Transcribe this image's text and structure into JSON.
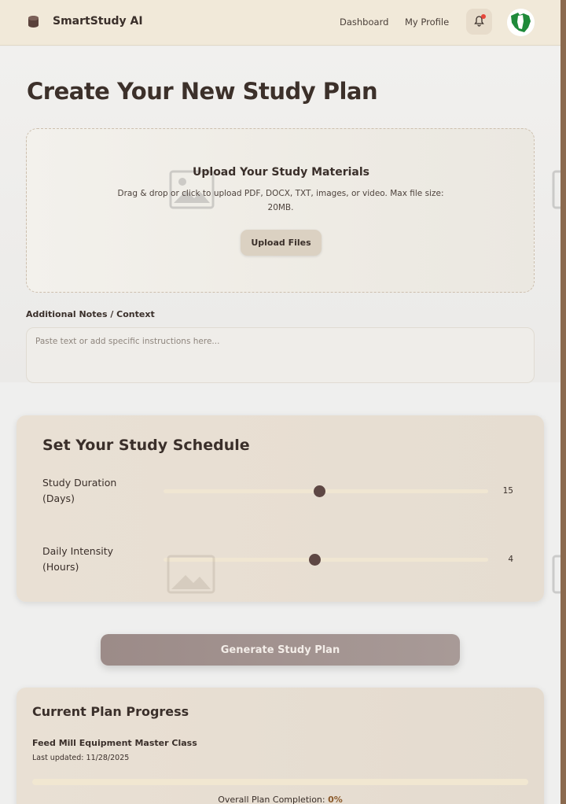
{
  "header": {
    "brand": "SmartStudy AI",
    "nav": [
      "Dashboard",
      "My Profile"
    ],
    "notification_dot_color": "#e6463a"
  },
  "main": {
    "title": "Create Your New Study Plan",
    "upload": {
      "title": "Upload Your Study Materials",
      "description": "Drag & drop or click to upload PDF, DOCX, TXT, images, or video. Max file size: 20MB.",
      "button": "Upload Files"
    },
    "notes": {
      "label": "Additional Notes / Context",
      "placeholder": "Paste text or add specific instructions here..."
    }
  },
  "schedule": {
    "title": "Set Your Study Schedule",
    "duration": {
      "label_line1": "Study Duration",
      "label_line2": "(Days)",
      "value": "15",
      "fraction": 0.48
    },
    "intensity": {
      "label_line1": "Daily Intensity",
      "label_line2": "(Hours)",
      "value": "4",
      "fraction": 0.465
    }
  },
  "generate_button": "Generate Study Plan",
  "progress": {
    "title": "Current Plan Progress",
    "plan_name": "Feed Mill Equipment Master Class",
    "last_updated": "Last updated: 11/28/2025",
    "completion_label": "Overall Plan Completion:",
    "completion_value": "0%",
    "completion_fraction": 0
  },
  "colors": {
    "accent": "#8b6a4f",
    "dark_text": "#3a2f2a",
    "slider_thumb": "#5e4744"
  }
}
